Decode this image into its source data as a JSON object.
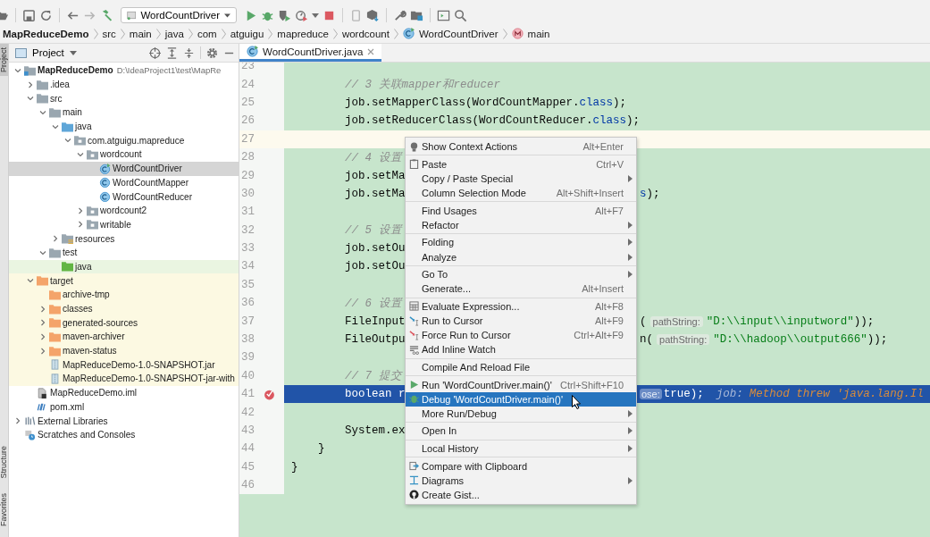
{
  "toolbar": {
    "run_configuration": "WordCountDriver"
  },
  "breadcrumbs": [
    {
      "label": "MapReduceDemo",
      "kind": "project"
    },
    {
      "label": "src",
      "kind": "folder"
    },
    {
      "label": "main",
      "kind": "folder"
    },
    {
      "label": "java",
      "kind": "folder"
    },
    {
      "label": "com",
      "kind": "folder"
    },
    {
      "label": "atguigu",
      "kind": "folder"
    },
    {
      "label": "mapreduce",
      "kind": "folder"
    },
    {
      "label": "wordcount",
      "kind": "folder"
    },
    {
      "label": "WordCountDriver",
      "kind": "class"
    },
    {
      "label": "main",
      "kind": "method"
    }
  ],
  "side_tabs": [
    {
      "label": "Project",
      "selected": true
    },
    {
      "label": "Structure",
      "selected": false
    },
    {
      "label": "Favorites",
      "selected": false
    }
  ],
  "project_panel": {
    "title": "Project",
    "tree": [
      {
        "label": "MapReduceDemo",
        "path": "D:\\IdeaProject1\\test\\MapRe",
        "kind": "module",
        "expanded": true,
        "selected": false,
        "children": [
          {
            "label": ".idea",
            "kind": "folder",
            "expanded": false,
            "selected": false
          },
          {
            "label": "src",
            "kind": "folder",
            "expanded": true,
            "selected": false,
            "children": [
              {
                "label": "main",
                "kind": "folder",
                "expanded": true,
                "selected": false,
                "children": [
                  {
                    "label": "java",
                    "kind": "source-folder",
                    "expanded": true,
                    "selected": false,
                    "children": [
                      {
                        "label": "com.atguigu.mapreduce",
                        "kind": "package",
                        "expanded": true,
                        "selected": false,
                        "children": [
                          {
                            "label": "wordcount",
                            "kind": "package",
                            "expanded": true,
                            "selected": false,
                            "children": [
                              {
                                "label": "WordCountDriver",
                                "kind": "runnable-class",
                                "selected": true
                              },
                              {
                                "label": "WordCountMapper",
                                "kind": "class",
                                "selected": false
                              },
                              {
                                "label": "WordCountReducer",
                                "kind": "class",
                                "selected": false
                              }
                            ]
                          },
                          {
                            "label": "wordcount2",
                            "kind": "package",
                            "expanded": false,
                            "selected": false
                          },
                          {
                            "label": "writable",
                            "kind": "package",
                            "expanded": false,
                            "selected": false
                          }
                        ]
                      }
                    ]
                  },
                  {
                    "label": "resources",
                    "kind": "resources-folder",
                    "expanded": false,
                    "selected": false
                  }
                ]
              },
              {
                "label": "test",
                "kind": "folder",
                "expanded": true,
                "selected": false,
                "children": [
                  {
                    "label": "java",
                    "kind": "test-folder",
                    "selected": false
                  }
                ]
              }
            ]
          },
          {
            "label": "target",
            "kind": "excluded-folder",
            "expanded": true,
            "selected": false,
            "children": [
              {
                "label": "archive-tmp",
                "kind": "excluded-folder",
                "selected": false
              },
              {
                "label": "classes",
                "kind": "excluded-folder",
                "expanded": false,
                "selected": false
              },
              {
                "label": "generated-sources",
                "kind": "excluded-folder",
                "expanded": false,
                "selected": false
              },
              {
                "label": "maven-archiver",
                "kind": "excluded-folder",
                "expanded": false,
                "selected": false
              },
              {
                "label": "maven-status",
                "kind": "excluded-folder",
                "expanded": false,
                "selected": false
              },
              {
                "label": "MapReduceDemo-1.0-SNAPSHOT.jar",
                "kind": "jar",
                "selected": false
              },
              {
                "label": "MapReduceDemo-1.0-SNAPSHOT-jar-with",
                "kind": "jar",
                "selected": false
              }
            ]
          },
          {
            "label": "MapReduceDemo.iml",
            "kind": "iml",
            "selected": false
          },
          {
            "label": "pom.xml",
            "kind": "pom",
            "selected": false
          }
        ]
      },
      {
        "label": "External Libraries",
        "kind": "libraries",
        "expanded": false,
        "selected": false
      },
      {
        "label": "Scratches and Consoles",
        "kind": "scratches",
        "selected": false
      }
    ]
  },
  "editor": {
    "tabs": [
      {
        "label": "WordCountDriver.java",
        "selected": true
      }
    ],
    "lines": [
      {
        "number": "23",
        "kind": "plain",
        "breakpoint": false
      },
      {
        "number": "24",
        "kind": "plain",
        "breakpoint": false,
        "left": [
          {
            "text": "        // 3 关联mapper和reducer",
            "kind": "comment"
          }
        ]
      },
      {
        "number": "25",
        "kind": "plain",
        "breakpoint": false,
        "left": [
          {
            "text": "        job.setMapperClass(WordCountMapper.",
            "kind": "plain"
          },
          {
            "text": "class",
            "kind": "field"
          },
          {
            "text": ");",
            "kind": "plain"
          }
        ]
      },
      {
        "number": "26",
        "kind": "plain",
        "breakpoint": false,
        "left": [
          {
            "text": "        job.setReducerClass(WordCountReducer.",
            "kind": "plain"
          },
          {
            "text": "class",
            "kind": "field"
          },
          {
            "text": ");",
            "kind": "plain"
          }
        ]
      },
      {
        "number": "27",
        "kind": "caret",
        "breakpoint": false
      },
      {
        "number": "28",
        "kind": "plain",
        "breakpoint": false,
        "left": [
          {
            "text": "        // 4 设置",
            "kind": "comment"
          }
        ]
      },
      {
        "number": "29",
        "kind": "plain",
        "breakpoint": false,
        "left": [
          {
            "text": "        job.setMa",
            "kind": "plain"
          }
        ]
      },
      {
        "number": "30",
        "kind": "plain",
        "breakpoint": false,
        "left": [
          {
            "text": "        job.setMa",
            "kind": "plain"
          }
        ],
        "right": [
          {
            "text": "s",
            "kind": "field"
          },
          {
            "text": ");",
            "kind": "plain"
          }
        ]
      },
      {
        "number": "31",
        "kind": "plain",
        "breakpoint": false
      },
      {
        "number": "32",
        "kind": "plain",
        "breakpoint": false,
        "left": [
          {
            "text": "        // 5 设置",
            "kind": "comment"
          }
        ]
      },
      {
        "number": "33",
        "kind": "plain",
        "breakpoint": false,
        "left": [
          {
            "text": "        job.setOu",
            "kind": "plain"
          }
        ]
      },
      {
        "number": "34",
        "kind": "plain",
        "breakpoint": false,
        "left": [
          {
            "text": "        job.setOu",
            "kind": "plain"
          }
        ]
      },
      {
        "number": "35",
        "kind": "plain",
        "breakpoint": false
      },
      {
        "number": "36",
        "kind": "plain",
        "breakpoint": false,
        "left": [
          {
            "text": "        // 6 设置",
            "kind": "comment"
          }
        ]
      },
      {
        "number": "37",
        "kind": "plain",
        "breakpoint": false,
        "left": [
          {
            "text": "        FileInput",
            "kind": "plain"
          }
        ],
        "right": [
          {
            "text": "(",
            "kind": "plain"
          },
          {
            "text": "pathString:",
            "kind": "hint"
          },
          {
            "text": "\"D:\\\\input\\\\inputword\"",
            "kind": "string"
          },
          {
            "text": "));",
            "kind": "plain"
          }
        ]
      },
      {
        "number": "38",
        "kind": "plain",
        "breakpoint": false,
        "left": [
          {
            "text": "        FileOutpu",
            "kind": "plain"
          }
        ],
        "right": [
          {
            "text": "n(",
            "kind": "plain"
          },
          {
            "text": "pathString:",
            "kind": "hint"
          },
          {
            "text": "\"D:\\\\hadoop\\\\output666\"",
            "kind": "string"
          },
          {
            "text": "));",
            "kind": "plain"
          }
        ]
      },
      {
        "number": "39",
        "kind": "plain",
        "breakpoint": false
      },
      {
        "number": "40",
        "kind": "plain",
        "breakpoint": false,
        "left": [
          {
            "text": "        // 7 提交",
            "kind": "comment"
          }
        ]
      },
      {
        "number": "41",
        "kind": "execution",
        "breakpoint": true,
        "left": [
          {
            "text": "        boolean r",
            "kind": "plain"
          }
        ],
        "right": [
          {
            "text": "ose:",
            "kind": "hint"
          },
          {
            "text": "true);",
            "kind": "plain"
          },
          {
            "text": "job:",
            "kind": "debug-label"
          },
          {
            "text": "Method threw 'java.lang.Il",
            "kind": "debug-value"
          }
        ]
      },
      {
        "number": "42",
        "kind": "plain",
        "breakpoint": false
      },
      {
        "number": "43",
        "kind": "plain",
        "breakpoint": false,
        "left": [
          {
            "text": "        System.ex",
            "kind": "plain"
          }
        ]
      },
      {
        "number": "44",
        "kind": "plain",
        "breakpoint": false,
        "left": [
          {
            "text": "    }",
            "kind": "plain"
          }
        ]
      },
      {
        "number": "45",
        "kind": "plain",
        "breakpoint": false,
        "left": [
          {
            "text": "}",
            "kind": "plain"
          }
        ]
      },
      {
        "number": "46",
        "kind": "plain",
        "breakpoint": false
      }
    ]
  },
  "context_menu": {
    "groups": [
      [
        {
          "label": "Show Context Actions",
          "shortcut": "Alt+Enter",
          "kind": "bulb",
          "submenu": false,
          "selected": false
        }
      ],
      [
        {
          "label": "Paste",
          "shortcut": "Ctrl+V",
          "kind": "clipboard",
          "submenu": false,
          "selected": false
        },
        {
          "label": "Copy / Paste Special",
          "kind": "plain",
          "submenu": true,
          "selected": false
        },
        {
          "label": "Column Selection Mode",
          "shortcut": "Alt+Shift+Insert",
          "kind": "plain",
          "submenu": false,
          "selected": false
        }
      ],
      [
        {
          "label": "Find Usages",
          "shortcut": "Alt+F7",
          "kind": "plain",
          "submenu": false,
          "selected": false
        },
        {
          "label": "Refactor",
          "kind": "plain",
          "submenu": true,
          "selected": false
        }
      ],
      [
        {
          "label": "Folding",
          "kind": "plain",
          "submenu": true,
          "selected": false
        },
        {
          "label": "Analyze",
          "kind": "plain",
          "submenu": true,
          "selected": false
        }
      ],
      [
        {
          "label": "Go To",
          "kind": "plain",
          "submenu": true,
          "selected": false
        },
        {
          "label": "Generate...",
          "shortcut": "Alt+Insert",
          "kind": "plain",
          "submenu": false,
          "selected": false
        }
      ],
      [
        {
          "label": "Evaluate Expression...",
          "shortcut": "Alt+F8",
          "kind": "calculator",
          "submenu": false,
          "selected": false
        },
        {
          "label": "Run to Cursor",
          "shortcut": "Alt+F9",
          "kind": "run-to-cursor",
          "submenu": false,
          "selected": false
        },
        {
          "label": "Force Run to Cursor",
          "shortcut": "Ctrl+Alt+F9",
          "kind": "force-run-to-cursor",
          "submenu": false,
          "selected": false
        },
        {
          "label": "Add Inline Watch",
          "kind": "watch",
          "submenu": false,
          "selected": false
        }
      ],
      [
        {
          "label": "Compile And Reload File",
          "kind": "plain",
          "submenu": false,
          "selected": false
        }
      ],
      [
        {
          "label": "Run 'WordCountDriver.main()'",
          "shortcut": "Ctrl+Shift+F10",
          "kind": "run",
          "submenu": false,
          "selected": false
        },
        {
          "label": "Debug 'WordCountDriver.main()'",
          "kind": "debug",
          "submenu": false,
          "selected": true
        },
        {
          "label": "More Run/Debug",
          "kind": "plain",
          "submenu": true,
          "selected": false
        }
      ],
      [
        {
          "label": "Open In",
          "kind": "plain",
          "submenu": true,
          "selected": false
        }
      ],
      [
        {
          "label": "Local History",
          "kind": "plain",
          "submenu": true,
          "selected": false
        }
      ],
      [
        {
          "label": "Compare with Clipboard",
          "kind": "compare",
          "submenu": false,
          "selected": false
        },
        {
          "label": "Diagrams",
          "kind": "diagram",
          "submenu": true,
          "selected": false
        },
        {
          "label": "Create Gist...",
          "kind": "gist",
          "submenu": false,
          "selected": false
        }
      ]
    ]
  }
}
